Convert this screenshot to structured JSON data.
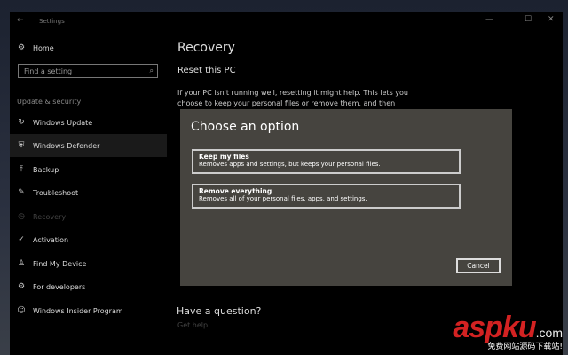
{
  "window": {
    "title": "Settings",
    "back": "←",
    "minimize": "—",
    "maximize": "☐",
    "close": "✕"
  },
  "sidebar": {
    "home": "Home",
    "search_placeholder": "Find a setting",
    "section": "Update & security",
    "items": [
      {
        "label": "Windows Update",
        "icon": "↻"
      },
      {
        "label": "Windows Defender",
        "icon": "⛨"
      },
      {
        "label": "Backup",
        "icon": "⤒"
      },
      {
        "label": "Troubleshoot",
        "icon": "✎"
      },
      {
        "label": "Recovery",
        "icon": "◷"
      },
      {
        "label": "Activation",
        "icon": "✓"
      },
      {
        "label": "Find My Device",
        "icon": "♙"
      },
      {
        "label": "For developers",
        "icon": "⚙"
      },
      {
        "label": "Windows Insider Program",
        "icon": "☺"
      }
    ]
  },
  "main": {
    "title": "Recovery",
    "subtitle": "Reset this PC",
    "description": "If your PC isn't running well, resetting it might help. This lets you choose to keep your personal files or remove them, and then",
    "question": "Have a question?",
    "help": "Get help"
  },
  "dialog": {
    "title": "Choose an option",
    "options": [
      {
        "title": "Keep my files",
        "desc": "Removes apps and settings, but keeps your personal files."
      },
      {
        "title": "Remove everything",
        "desc": "Removes all of your personal files, apps, and settings."
      }
    ],
    "cancel": "Cancel"
  },
  "watermark": {
    "brand": "aspku",
    ".com": ".com",
    "domain": ".com",
    "slogan": "免费网站源码下载站!"
  }
}
